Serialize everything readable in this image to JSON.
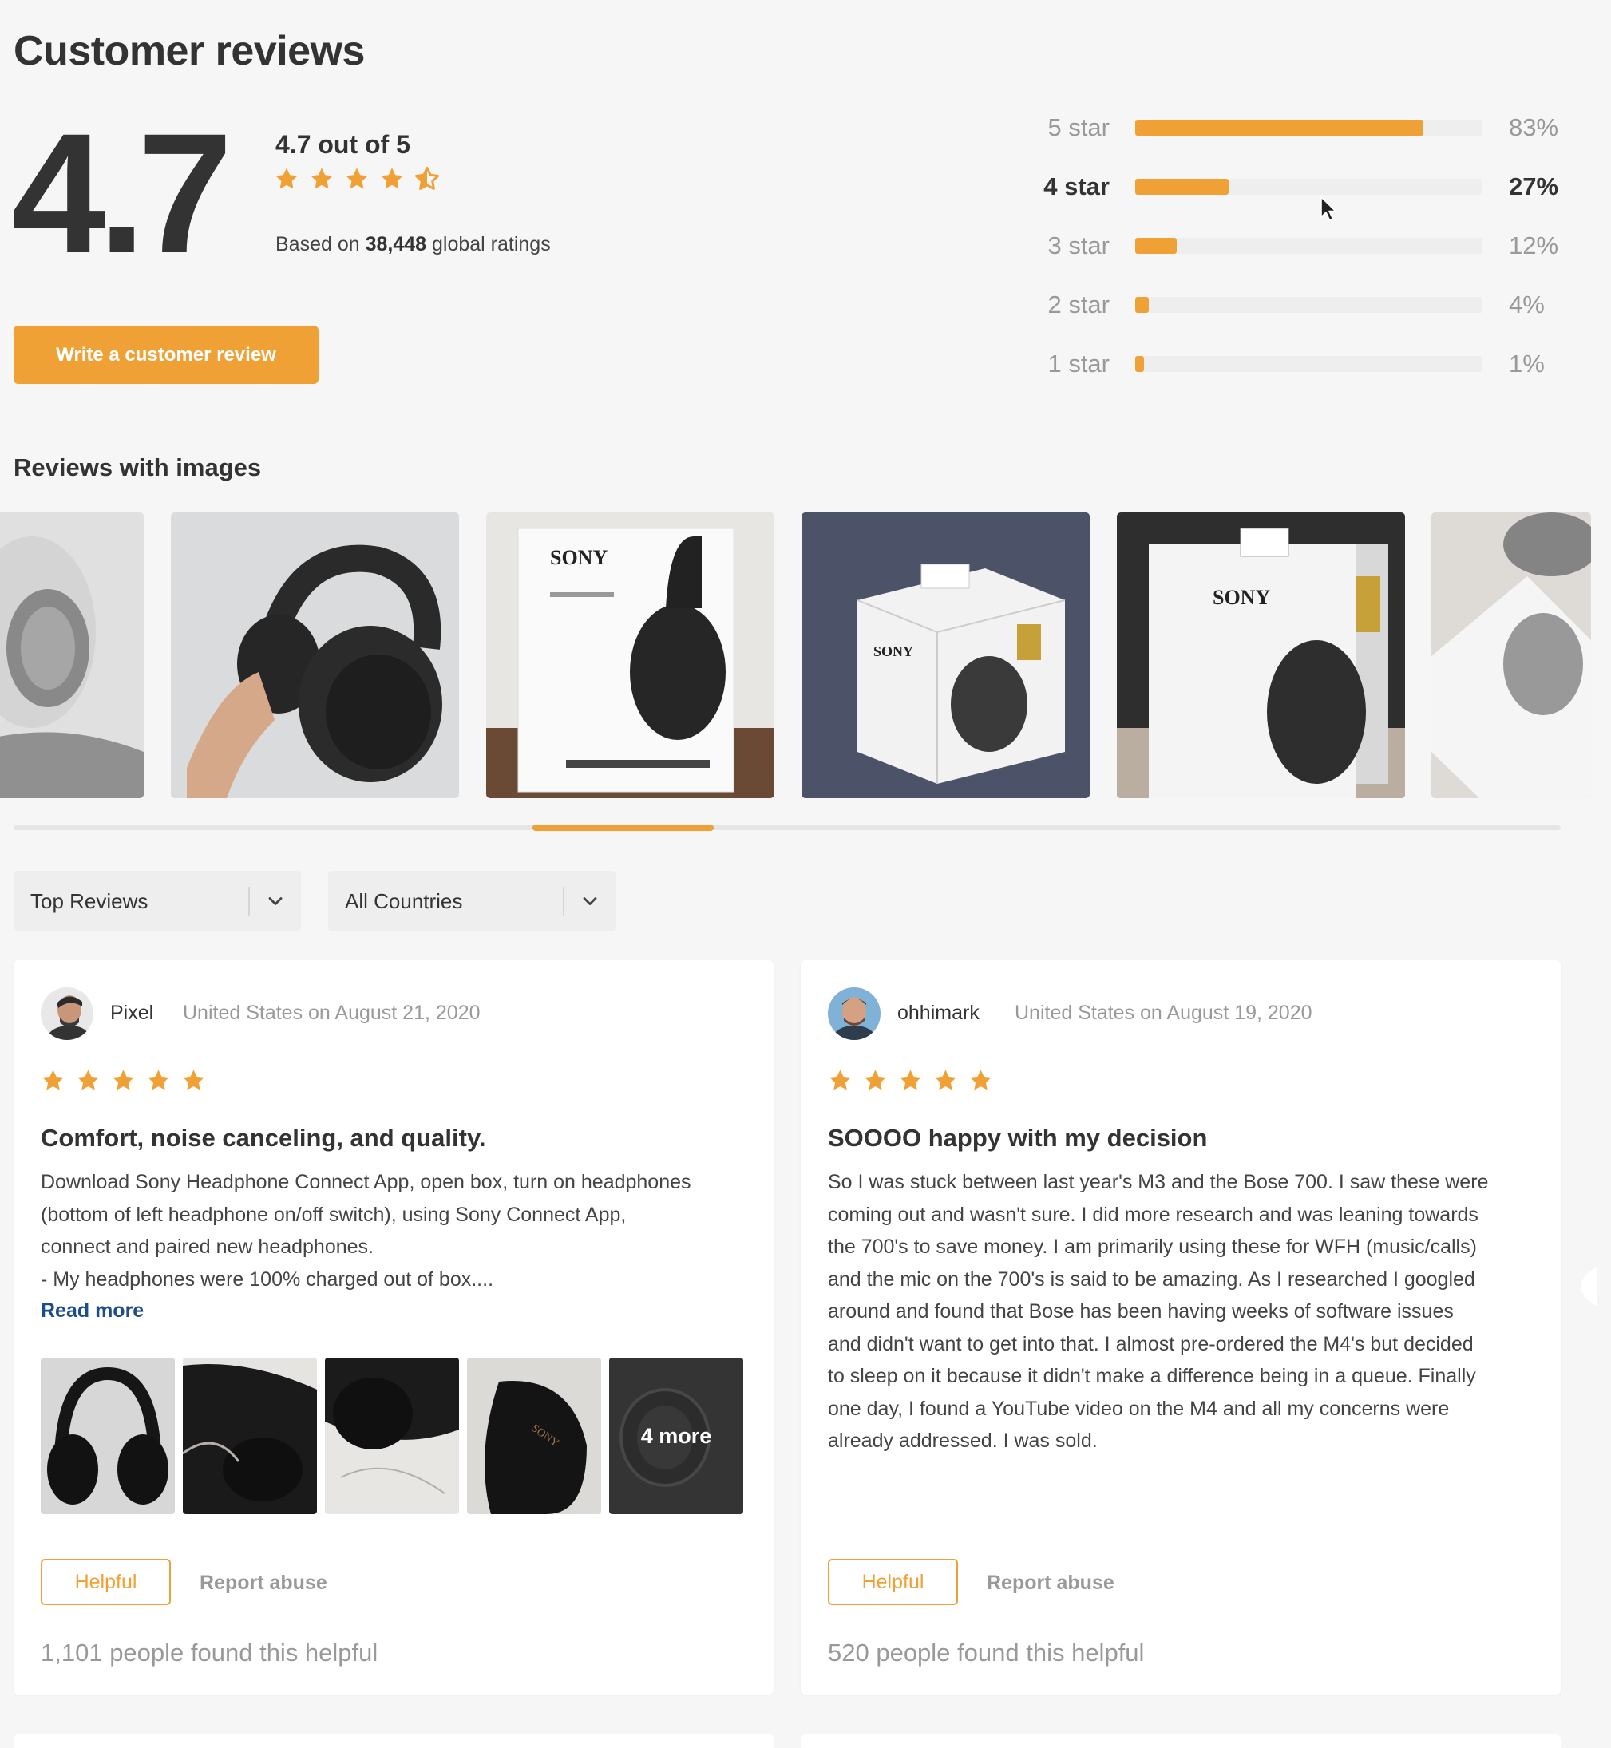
{
  "header": {
    "title": "Customer reviews"
  },
  "summary": {
    "rating_big": "4.7",
    "rating_text": "4.7 out of 5",
    "stars": 4.5,
    "based_on_prefix": "Based on ",
    "ratings_count": "38,448",
    "based_on_suffix": " global ratings",
    "write_review_label": "Write a customer review"
  },
  "histogram": [
    {
      "label": "5 star",
      "percent": 83,
      "percent_text": "83%"
    },
    {
      "label": "4 star",
      "percent": 27,
      "percent_text": "27%",
      "highlighted": true
    },
    {
      "label": "3 star",
      "percent": 12,
      "percent_text": "12%"
    },
    {
      "label": "2 star",
      "percent": 4,
      "percent_text": "4%"
    },
    {
      "label": "1 star",
      "percent": 1,
      "percent_text": "1%"
    }
  ],
  "reviews_with_images": {
    "title": "Reviews with images",
    "images": [
      "headphones-worn",
      "headphones-held",
      "sony-box",
      "sony-box-on-rug",
      "sony-box-dark",
      "sony-box-faded"
    ],
    "scroll_position": 0.38
  },
  "filters": {
    "sort": {
      "label": "Top Reviews"
    },
    "country": {
      "label": "All Countries"
    }
  },
  "reviews": [
    {
      "reviewer": "Pixel",
      "meta": "United States on August 21, 2020",
      "stars": 5,
      "title": "Comfort, noise canceling, and quality.",
      "body": [
        "Download Sony Headphone Connect App, open box, turn on headphones",
        "(bottom of left headphone on/off switch), using Sony Connect App,",
        "connect and paired new headphones.",
        "- My headphones were 100% charged out of box...."
      ],
      "read_more": "Read more",
      "more_images": "4 more",
      "helpful_label": "Helpful",
      "report_label": "Report abuse",
      "helpful_count": "1,101 people found this helpful"
    },
    {
      "reviewer": "ohhimark",
      "meta": "United States on August 19, 2020",
      "stars": 5,
      "title": "SOOOO happy with my decision",
      "body": [
        "So I was stuck between last year's M3 and the Bose 700. I saw these were",
        "coming out and wasn't sure. I did more research and was leaning towards",
        "the 700's to save money. I am primarily using these for WFH (music/calls)",
        "and the mic on the 700's is said to be amazing. As I researched I googled",
        "around and found that Bose has been having weeks of software issues",
        "and didn't want to get into that. I almost pre-ordered the M4's but decided",
        "to sleep on it because it didn't make a difference being in a queue. Finally",
        "one day, I found a YouTube video on the M4 and all my concerns were",
        "already addressed. I was sold."
      ],
      "helpful_label": "Helpful",
      "report_label": "Report abuse",
      "helpful_count": "520 people found this helpful"
    }
  ],
  "colors": {
    "accent": "#f0a136",
    "link": "#1e4d8c",
    "muted": "#999999",
    "track": "#eeeeee"
  }
}
